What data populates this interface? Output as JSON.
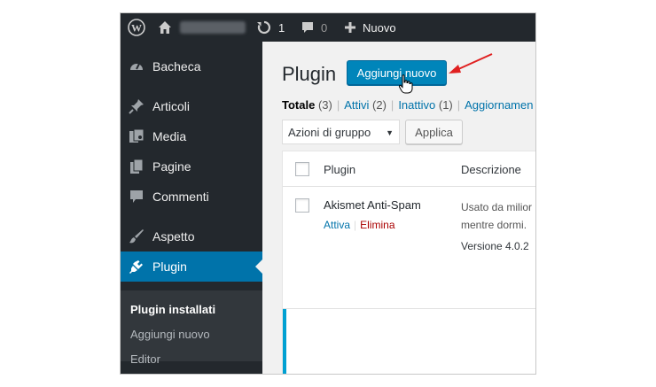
{
  "adminbar": {
    "comments_count_updates": "1",
    "comments_count": "0",
    "new_label": "Nuovo"
  },
  "sidebar": {
    "items": [
      {
        "label": "Bacheca",
        "icon": "dashboard-icon"
      },
      {
        "label": "Articoli",
        "icon": "pin-icon"
      },
      {
        "label": "Media",
        "icon": "media-icon"
      },
      {
        "label": "Pagine",
        "icon": "pages-icon"
      },
      {
        "label": "Commenti",
        "icon": "comment-icon"
      },
      {
        "label": "Aspetto",
        "icon": "brush-icon"
      },
      {
        "label": "Plugin",
        "icon": "plugin-icon"
      }
    ],
    "submenu": [
      "Plugin installati",
      "Aggiungi nuovo",
      "Editor"
    ]
  },
  "main": {
    "title": "Plugin",
    "add_new_label": "Aggiungi nuovo",
    "filters": [
      {
        "label": "Totale",
        "count": "(3)"
      },
      {
        "label": "Attivi",
        "count": "(2)"
      },
      {
        "label": "Inattivo",
        "count": "(1)"
      },
      {
        "label": "Aggiornamen",
        "count": ""
      }
    ],
    "bulk_actions_label": "Azioni di gruppo",
    "apply_label": "Applica",
    "table": {
      "col_plugin": "Plugin",
      "col_description": "Descrizione",
      "rows": [
        {
          "name": "Akismet Anti-Spam",
          "activate": "Attiva",
          "separator": "|",
          "delete": "Elimina",
          "description_line1": "Usato da milior",
          "description_line2": "mentre dormi.",
          "version": "Versione 4.0.2"
        }
      ]
    }
  },
  "colors": {
    "adminbar_bg": "#23282d",
    "sidebar_current": "#0073aa",
    "primary_button": "#0085ba",
    "link": "#0073aa",
    "delete_link": "#aa0000",
    "annotation_arrow": "#e02020"
  }
}
